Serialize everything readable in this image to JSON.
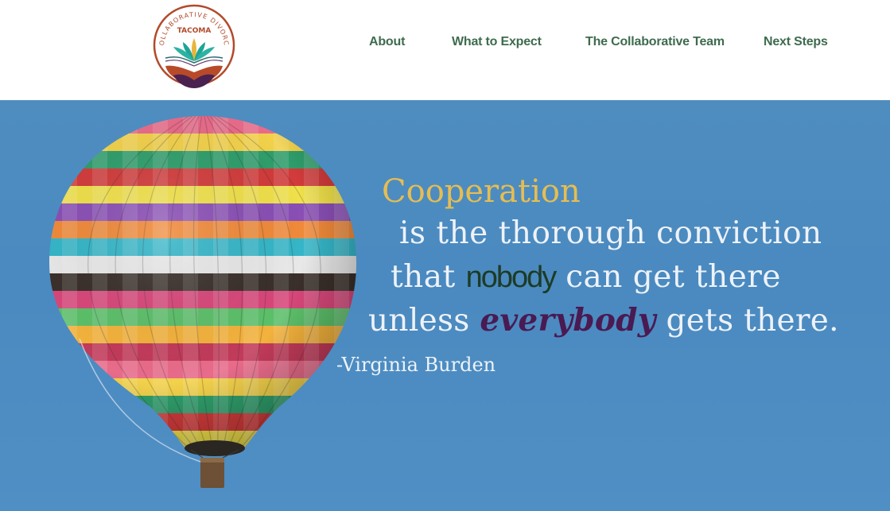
{
  "logo": {
    "arc_text": "COLLABORATIVE DIVORCE",
    "city": "TACOMA"
  },
  "nav": {
    "items": [
      {
        "label": "About"
      },
      {
        "label": "What to Expect"
      },
      {
        "label": "The Collaborative Team"
      },
      {
        "label": "Next Steps"
      }
    ]
  },
  "hero": {
    "quote": {
      "highlight": "Cooperation",
      "line2": "is the thorough conviction",
      "line3_before": "that ",
      "line3_emph": "nobody",
      "line3_after": " can get there",
      "line4_before": "unless ",
      "line4_emph": "everybody",
      "line4_after": " gets there."
    },
    "attribution": "-Virginia  Burden"
  },
  "colors": {
    "nav_text": "#3e6b4e",
    "sky": "#4a8ac0",
    "quote_highlight": "#e6bd52",
    "quote_text": "#eef2f8",
    "nobody": "#1d3b26",
    "everybody": "#4a1a52"
  }
}
